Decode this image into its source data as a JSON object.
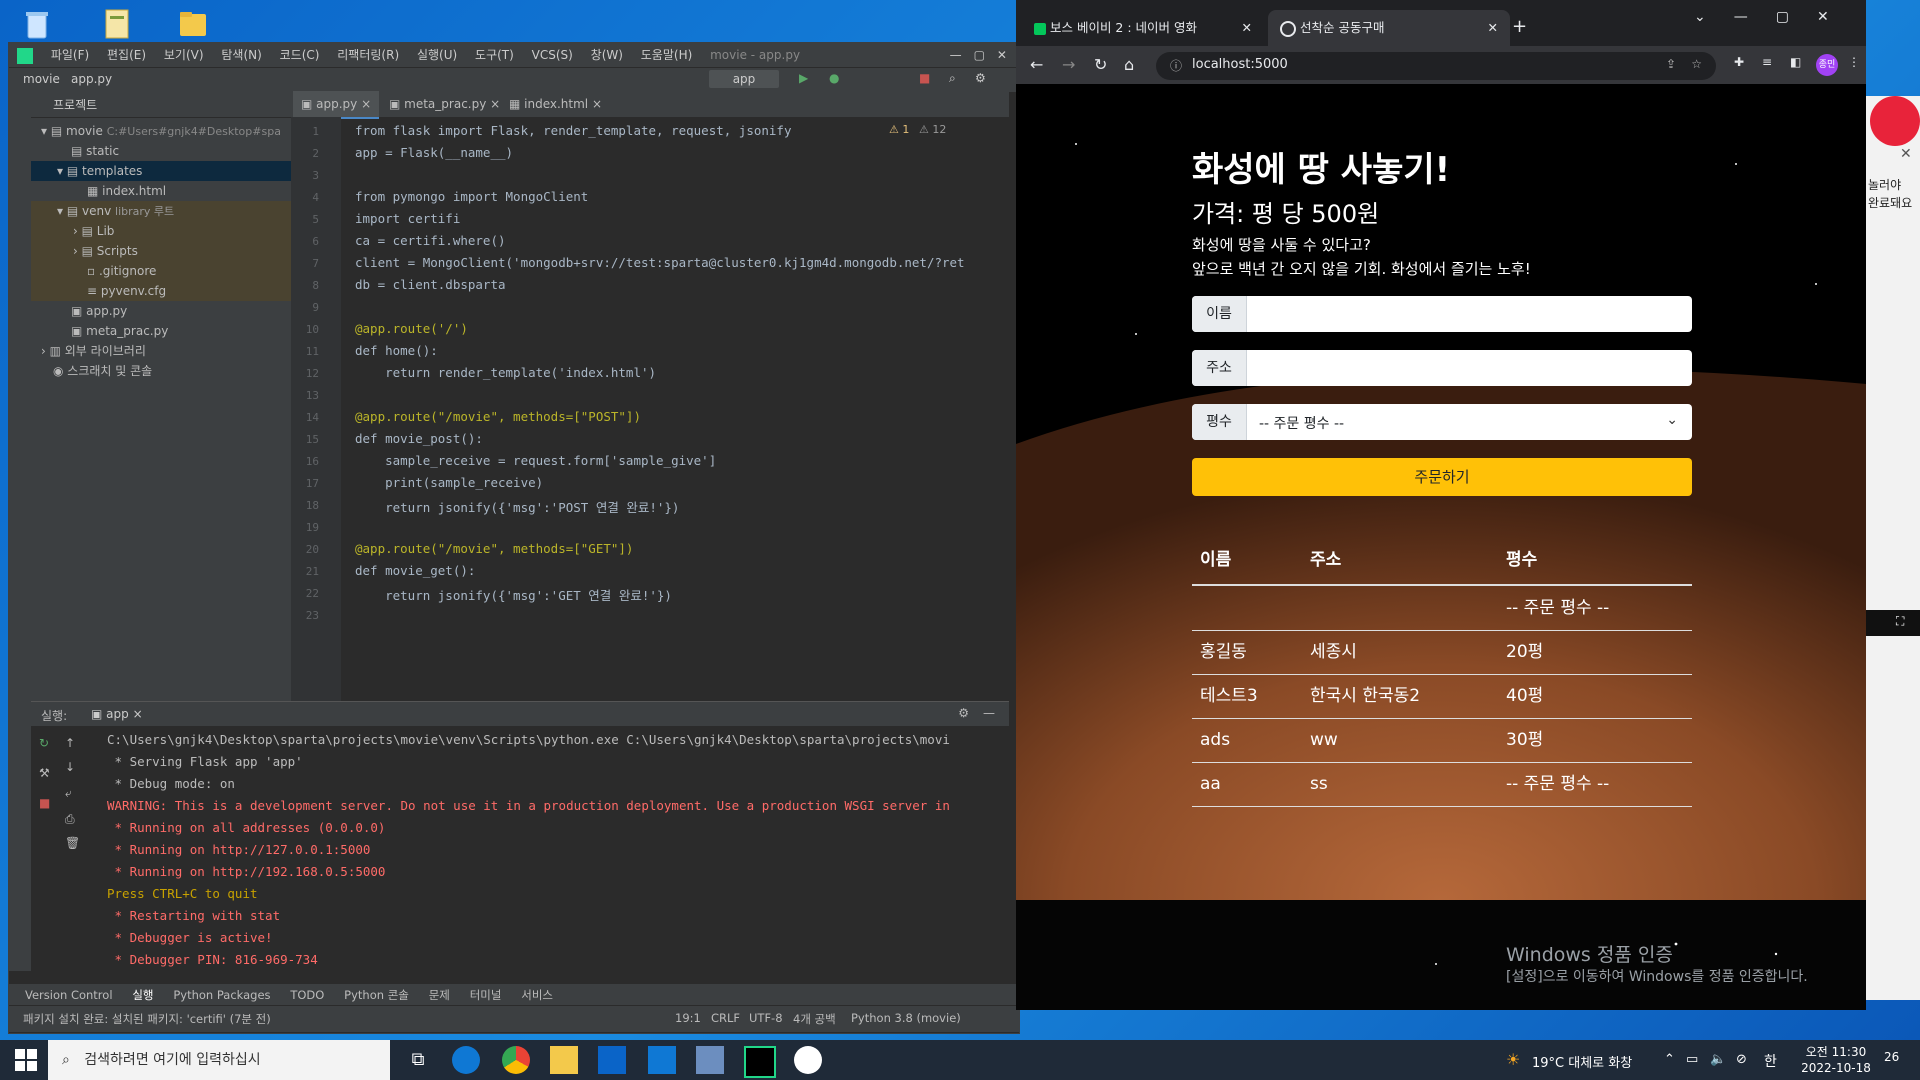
{
  "ide": {
    "menu": [
      "파일(F)",
      "편집(E)",
      "보기(V)",
      "탐색(N)",
      "코드(C)",
      "리팩터링(R)",
      "실행(U)",
      "도구(T)",
      "VCS(S)",
      "창(W)",
      "도움말(H)"
    ],
    "title": "movie - app.py",
    "breadcrumb": [
      "movie",
      "app.py"
    ],
    "run_config": "app",
    "project_label": "프로젝트",
    "tree": [
      {
        "label": "movie",
        "hint": "C:#Users#gnjk4#Desktop#spa"
      },
      {
        "label": "static",
        "hint": ""
      },
      {
        "label": "templates",
        "hint": ""
      },
      {
        "label": "index.html",
        "hint": ""
      },
      {
        "label": "venv",
        "hint": "library 루트"
      },
      {
        "label": "Lib",
        "hint": ""
      },
      {
        "label": "Scripts",
        "hint": ""
      },
      {
        "label": ".gitignore",
        "hint": ""
      },
      {
        "label": "pyvenv.cfg",
        "hint": ""
      },
      {
        "label": "app.py",
        "hint": ""
      },
      {
        "label": "meta_prac.py",
        "hint": ""
      },
      {
        "label": "외부 라이브러리",
        "hint": ""
      },
      {
        "label": "스크래치 및 콘솔",
        "hint": ""
      }
    ],
    "tabs": [
      "app.py",
      "meta_prac.py",
      "index.html"
    ],
    "inspection": {
      "warnings": "1",
      "weak": "12"
    },
    "code": [
      "from flask import Flask, render_template, request, jsonify",
      "app = Flask(__name__)",
      "",
      "from pymongo import MongoClient",
      "import certifi",
      "ca = certifi.where()",
      "client = MongoClient('mongodb+srv://test:sparta@cluster0.kj1gm4d.mongodb.net/?ret",
      "db = client.dbsparta",
      "",
      "@app.route('/')",
      "def home():",
      "    return render_template('index.html')",
      "",
      "@app.route(\"/movie\", methods=[\"POST\"])",
      "def movie_post():",
      "    sample_receive = request.form['sample_give']",
      "    print(sample_receive)",
      "    return jsonify({'msg':'POST 연결 완료!'})",
      "",
      "@app.route(\"/movie\", methods=[\"GET\"])",
      "def movie_get():",
      "    return jsonify({'msg':'GET 연결 완료!'})",
      ""
    ],
    "run": {
      "label": "실행:",
      "tab": "app",
      "lines": [
        {
          "text": "C:\\Users\\gnjk4\\Desktop\\sparta\\projects\\movie\\venv\\Scripts\\python.exe C:\\Users\\gnjk4\\Desktop\\sparta\\projects\\movi",
          "color": "#bbbbbb"
        },
        {
          "text": " * Serving Flask app 'app'",
          "color": "#bbbbbb"
        },
        {
          "text": " * Debug mode: on",
          "color": "#bbbbbb"
        },
        {
          "text": "WARNING: This is a development server. Do not use it in a production deployment. Use a production WSGI server in",
          "color": "#ff6b68"
        },
        {
          "text": " * Running on all addresses (0.0.0.0)",
          "color": "#ff6b68"
        },
        {
          "text": " * Running on http://127.0.0.1:5000",
          "color": "#ff6b68"
        },
        {
          "text": " * Running on http://192.168.0.5:5000",
          "color": "#ff6b68"
        },
        {
          "text": "Press CTRL+C to quit",
          "color": "#c8a200"
        },
        {
          "text": " * Restarting with stat",
          "color": "#ff6b68"
        },
        {
          "text": " * Debugger is active!",
          "color": "#ff6b68"
        },
        {
          "text": " * Debugger PIN: 816-969-734",
          "color": "#ff6b68"
        }
      ]
    },
    "bottom_tabs": [
      "Version Control",
      "실행",
      "Python Packages",
      "TODO",
      "Python 콘솔",
      "문제",
      "터미널",
      "서비스"
    ],
    "status_left": "패키지 설치 완료: 설치된 패키지: 'certifi' (7분 전)",
    "status_right": [
      "19:1",
      "CRLF",
      "UTF-8",
      "4개 공백",
      "Python 3.8 (movie)"
    ]
  },
  "browser": {
    "tabs": [
      {
        "label": "보스 베이비 2 : 네이버 영화"
      },
      {
        "label": "선착순 공동구매"
      }
    ],
    "url": "localhost:5000",
    "profile": "종민",
    "page": {
      "title": "화성에 땅 사놓기!",
      "price": "가격: 평 당 500원",
      "desc1": "화성에 땅을 사둘 수 있다고?",
      "desc2": "앞으로 백년 간 오지 않을 기회. 화성에서 즐기는 노후!",
      "name_label": "이름",
      "addr_label": "주소",
      "size_label": "평수",
      "size_placeholder": "-- 주문 평수 --",
      "order_button": "주문하기",
      "headers": [
        "이름",
        "주소",
        "평수"
      ],
      "rows": [
        [
          "",
          "",
          "-- 주문 평수 --"
        ],
        [
          "홍길동",
          "세종시",
          "20평"
        ],
        [
          "테스트3",
          "한국시 한국동2",
          "40평"
        ],
        [
          "ads",
          "ww",
          "30평"
        ],
        [
          "aa",
          "ss",
          "-- 주문 평수 --"
        ]
      ],
      "watermark1": "Windows 정품 인증",
      "watermark2": "[설정]으로 이동하여 Windows를 정품 인증합니다."
    }
  },
  "rightwin": {
    "text1": "놀러야",
    "text2": "완료돼요"
  },
  "taskbar": {
    "search_placeholder": "검색하려면 여기에 입력하십시",
    "weather": "19°C 대체로 화창",
    "ime": "한",
    "time": "오전 11:30",
    "date": "2022-10-18",
    "notifications": "26"
  },
  "colors": {
    "ide_bg": "#2b2b2b",
    "ide_panel": "#3c3f41",
    "browser_bg": "#202124",
    "order_button": "#ffc107",
    "accent_blue": "#4a88c7"
  }
}
